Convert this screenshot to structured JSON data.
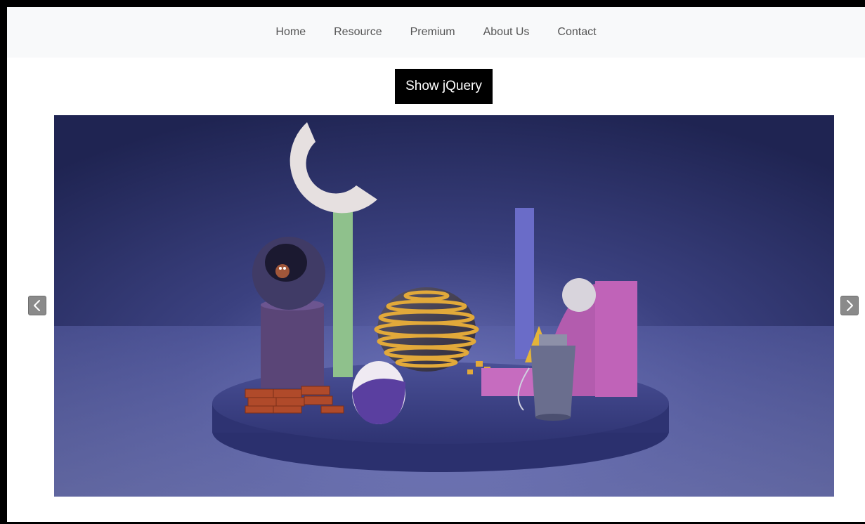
{
  "nav": {
    "items": [
      {
        "label": "Home"
      },
      {
        "label": "Resource"
      },
      {
        "label": "Premium"
      },
      {
        "label": "About Us"
      },
      {
        "label": "Contact"
      }
    ]
  },
  "toolbar": {
    "show_jquery_label": "Show jQuery"
  },
  "carousel": {
    "slide_alt": "3D abstract scene with geometric shapes on a circular platform",
    "prev_icon": "chevron-left-icon",
    "next_icon": "chevron-right-icon"
  },
  "colors": {
    "nav_background": "#f8f9fa",
    "nav_text": "#555555",
    "button_background": "#000000",
    "button_text": "#ffffff",
    "scene_background": "#262b5c"
  }
}
